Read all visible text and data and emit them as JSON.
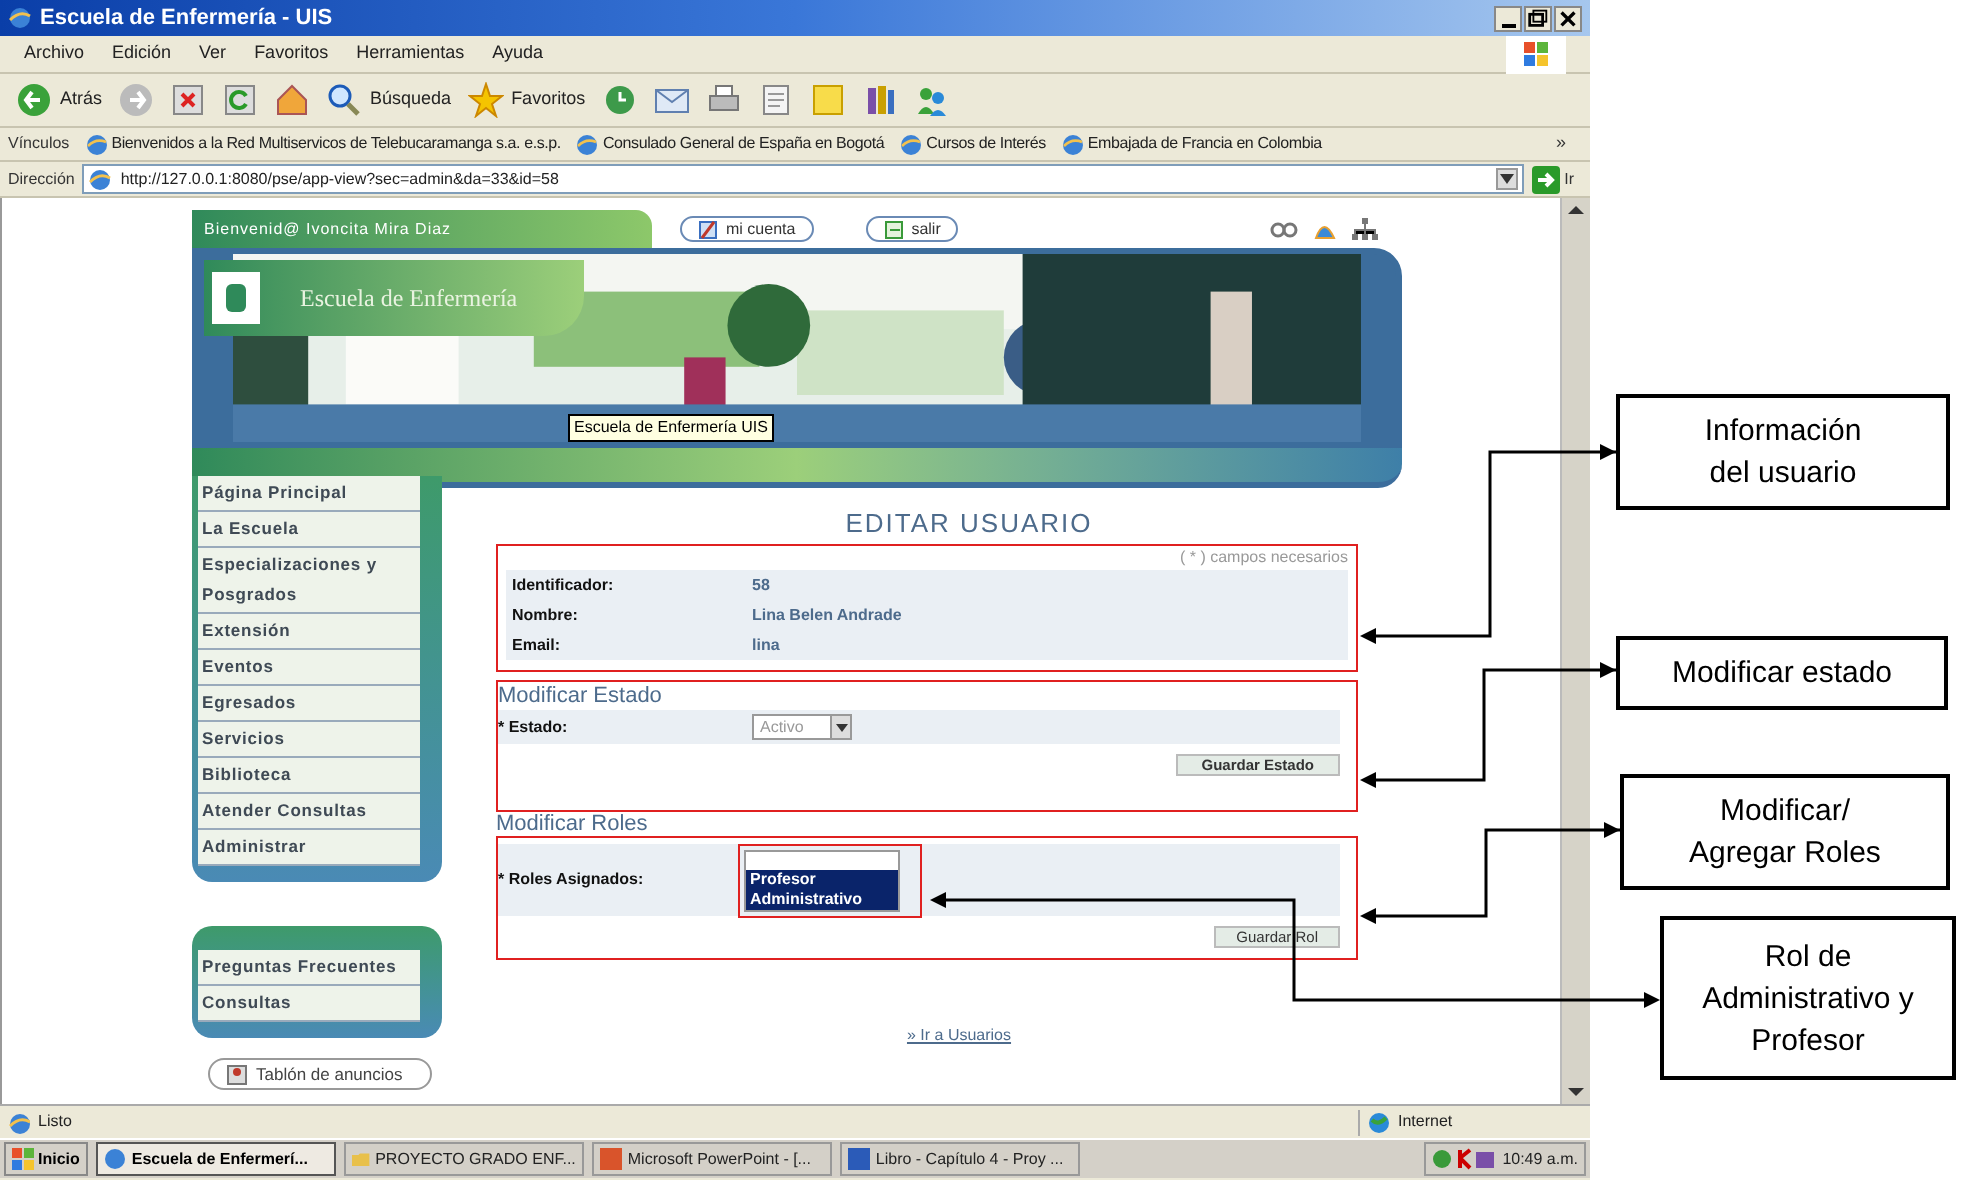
{
  "window": {
    "title": "Escuela de Enfermería - UIS"
  },
  "menu": [
    "Archivo",
    "Edición",
    "Ver",
    "Favoritos",
    "Herramientas",
    "Ayuda"
  ],
  "toolbar": [
    {
      "kind": "back",
      "label": "Atrás"
    },
    {
      "kind": "forward"
    },
    {
      "kind": "stop"
    },
    {
      "kind": "refresh"
    },
    {
      "kind": "home"
    },
    {
      "kind": "search",
      "label": "Búsqueda"
    },
    {
      "kind": "favorites",
      "label": "Favoritos"
    },
    {
      "kind": "history"
    },
    {
      "kind": "mail"
    },
    {
      "kind": "print"
    },
    {
      "kind": "edit"
    },
    {
      "kind": "notes"
    },
    {
      "kind": "research"
    },
    {
      "kind": "messenger"
    }
  ],
  "links_bar": {
    "label": "Vínculos",
    "links": [
      "Bienvenidos a la Red Multiservicos de Telebucaramanga s.a. e.s.p.",
      "Consulado General de España en Bogotá",
      "Cursos de Interés",
      "Embajada de Francia en Colombia"
    ],
    "more": "»"
  },
  "address_bar": {
    "label": "Dirección",
    "url": "http://127.0.0.1:8080/pse/app-view?sec=admin&da=33&id=58",
    "go": "Ir"
  },
  "page": {
    "welcome": "Bienvenid@ Ivoncita Mira Diaz",
    "top_buttons": [
      {
        "kind": "account",
        "label": "mi cuenta"
      },
      {
        "kind": "exit",
        "label": "salir"
      }
    ],
    "logo_text": "Escuela de Enfermería",
    "banner_tooltip": "Escuela de Enfermería UIS",
    "main_nav": [
      "Página Principal",
      "La Escuela",
      "Especializaciones y Posgrados",
      "Extensión",
      "Eventos",
      "Egresados",
      "Servicios",
      "Biblioteca",
      "Atender Consultas",
      "Administrar"
    ],
    "secondary_nav": [
      "Preguntas Frecuentes",
      "Consultas"
    ],
    "notice_button": "Tablón de anuncios",
    "title": "EDITAR USUARIO",
    "required_note": "( * ) campos necesarios",
    "user_info": [
      {
        "label": "Identificador:",
        "value": "58"
      },
      {
        "label": "Nombre:",
        "value": "Lina Belen Andrade"
      },
      {
        "label": "Email:",
        "value": "lina"
      }
    ],
    "status_section": {
      "heading": "Modificar Estado",
      "label": "* Estado:",
      "value": "Activo",
      "button": "Guardar Estado"
    },
    "roles_section": {
      "heading": "Modificar Roles",
      "label": "* Roles Asignados:",
      "options": [
        {
          "label": "Profesor",
          "selected": true
        },
        {
          "label": "Administrativo",
          "selected": true
        }
      ],
      "button": "Guardar Rol"
    },
    "back_link": "» Ir a Usuarios"
  },
  "status_bar": {
    "text": "Listo",
    "zone": "Internet"
  },
  "taskbar": {
    "start": "Inicio",
    "tasks": [
      {
        "label": "Escuela de Enfermerí...",
        "active": true
      },
      {
        "label": "PROYECTO GRADO ENF...",
        "active": false
      },
      {
        "label": "Microsoft PowerPoint - [...",
        "active": false
      },
      {
        "label": "Libro - Capítulo 4 - Proy ...",
        "active": false
      }
    ],
    "clock": "10:49 a.m."
  },
  "annotations": [
    "Información del usuario",
    "Modificar estado",
    "Modificar/ Agregar Roles",
    "Rol de Administrativo y Profesor"
  ]
}
